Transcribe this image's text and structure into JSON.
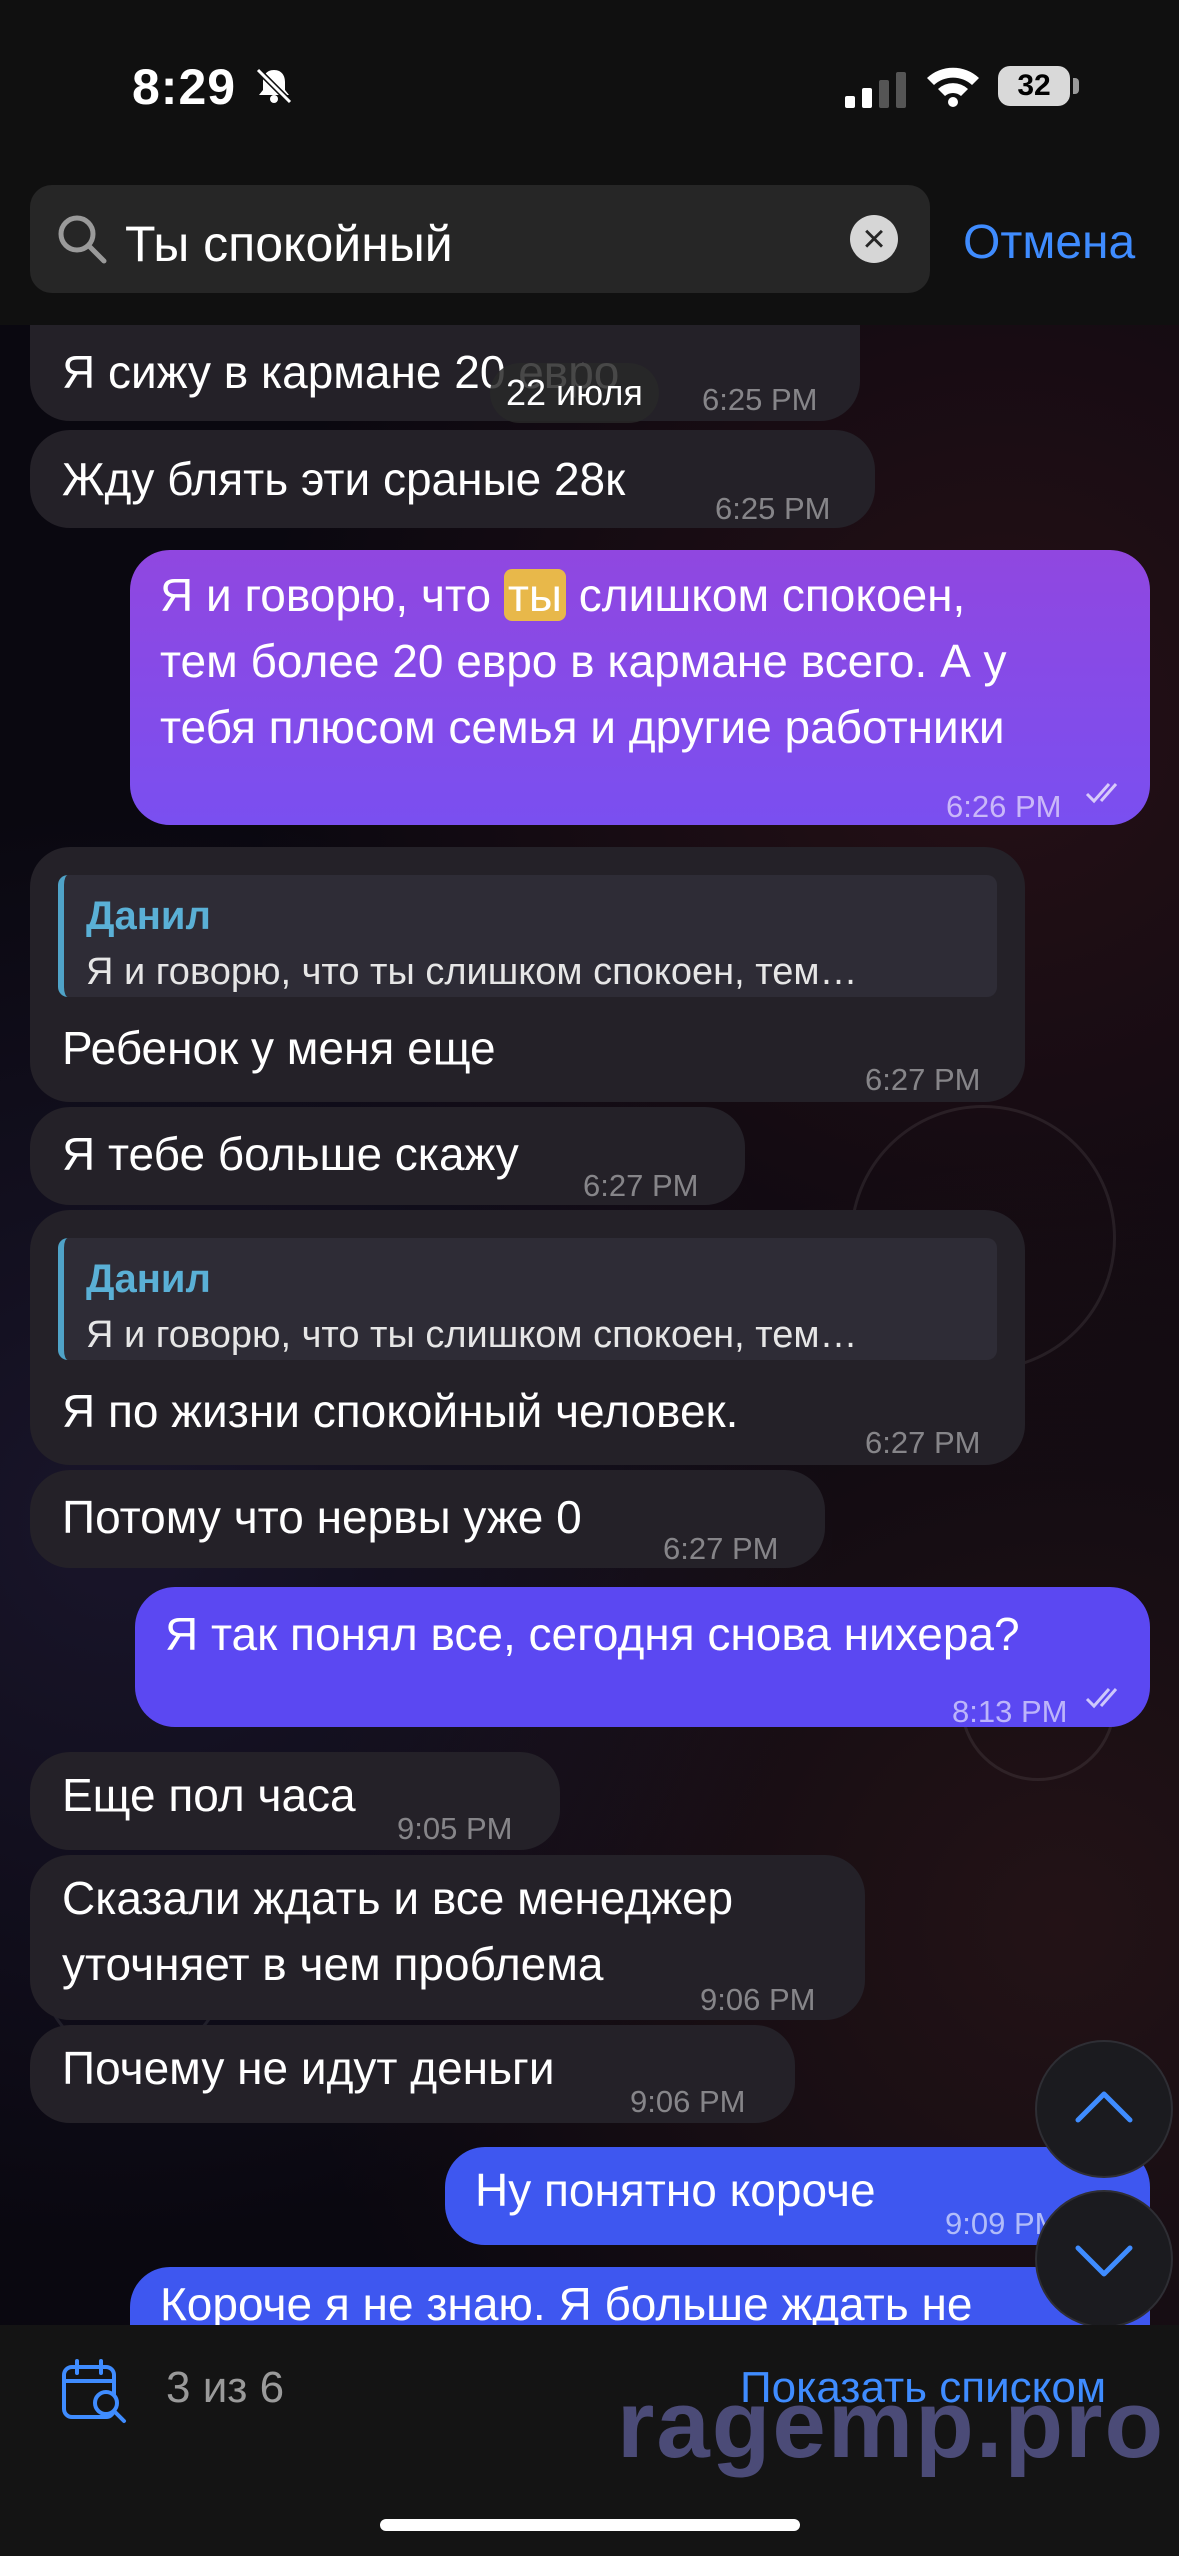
{
  "status": {
    "time": "8:29",
    "battery": "32"
  },
  "search": {
    "query": "Ты спокойный",
    "cancel_label": "Отмена"
  },
  "chat": {
    "date_chip": "22 июля",
    "messages": [
      {
        "text": "Я сижу в кармане 20 евро",
        "time": "6:25 PM"
      },
      {
        "text": "Жду блять эти сраные 28к",
        "time": "6:25 PM"
      },
      {
        "line1_pre": "Я и говорю, что ",
        "line1_hl": "ты",
        "line1_post": " слишком спокоен,",
        "line2": "тем более 20 евро в кармане всего. А у",
        "line3": "тебя плюсом семья и другие работники",
        "time": "6:26 PM"
      },
      {
        "reply_name": "Данил",
        "reply_text": "Я и говорю, что ты слишком спокоен, тем…",
        "text": "Ребенок у меня еще",
        "time": "6:27 PM"
      },
      {
        "text": "Я тебе больше скажу",
        "time": "6:27 PM"
      },
      {
        "reply_name": "Данил",
        "reply_text": "Я и говорю, что ты слишком спокоен, тем…",
        "text": "Я по жизни спокойный человек.",
        "time": "6:27 PM"
      },
      {
        "text": "Потому что нервы уже 0",
        "time": "6:27 PM"
      },
      {
        "text": "Я так понял все, сегодня снова нихера?",
        "time": "8:13 PM"
      },
      {
        "text": "Еще пол часа",
        "time": "9:05 PM"
      },
      {
        "line1": "Сказали ждать и все менеджер",
        "line2": "уточняет в чем проблема",
        "time": "9:06 PM"
      },
      {
        "text": "Почему не идут деньги",
        "time": "9:06 PM"
      },
      {
        "text": "Ну понятно короче",
        "time": "9:09 PM"
      },
      {
        "text": "Короче я не знаю. Я больше ждать не"
      }
    ]
  },
  "bottom": {
    "counter": "3 из 6",
    "list_label": "Показать списком",
    "watermark": "ragemp.pro"
  }
}
